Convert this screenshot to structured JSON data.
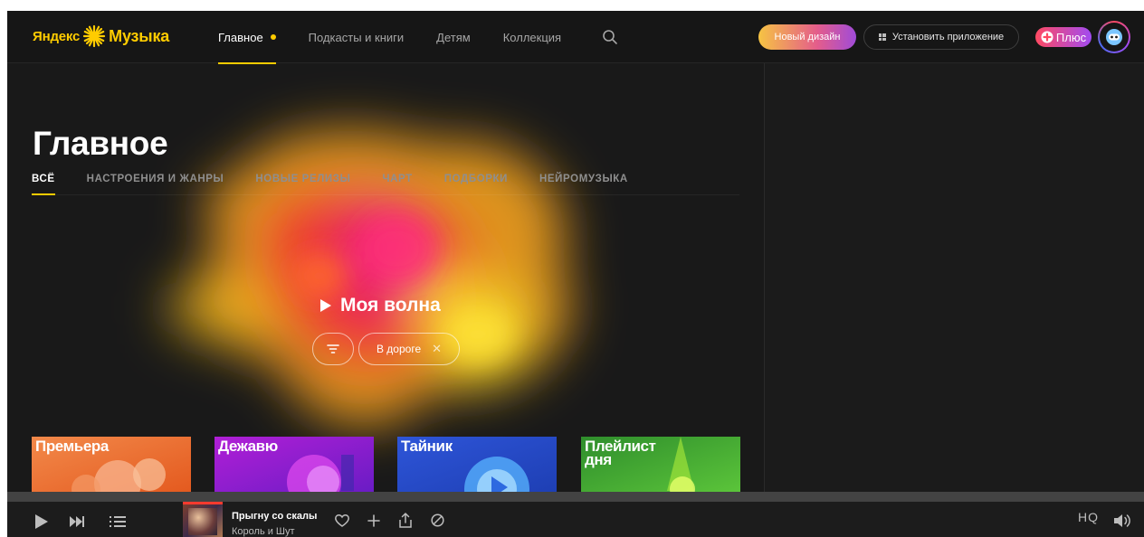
{
  "header": {
    "logo": {
      "brand": "Яндекс",
      "product": "Музыка"
    },
    "nav": [
      {
        "label": "Главное",
        "active": true
      },
      {
        "label": "Подкасты и книги",
        "active": false
      },
      {
        "label": "Детям",
        "active": false
      },
      {
        "label": "Коллекция",
        "active": false
      }
    ],
    "new_design_label": "Новый дизайн",
    "install_label": "Установить приложение",
    "plus_label": "Плюс"
  },
  "main": {
    "title": "Главное",
    "tabs": [
      {
        "label": "ВСЁ",
        "active": true
      },
      {
        "label": "НАСТРОЕНИЯ И ЖАНРЫ",
        "active": false
      },
      {
        "label": "НОВЫЕ РЕЛИЗЫ",
        "active": false
      },
      {
        "label": "ЧАРТ",
        "active": false
      },
      {
        "label": "ПОДБОРКИ",
        "active": false
      },
      {
        "label": "НЕЙРОМУЗЫКА",
        "active": false
      }
    ],
    "wave_label": "Моя волна",
    "mood_chip": "В дороге",
    "cards": [
      {
        "title": "Премьера",
        "color": "#e86a2a"
      },
      {
        "title": "Дежавю",
        "color": "#9b2ad1"
      },
      {
        "title": "Тайник",
        "color": "#2a5fd8"
      },
      {
        "title": "Плейлист дня",
        "color": "#3fa83a"
      }
    ]
  },
  "player": {
    "track_title": "Прыгну со скалы",
    "artist": "Король и Шут",
    "quality_label": "HQ"
  },
  "colors": {
    "accent": "#ffcc00",
    "background": "#1a1a1a"
  }
}
